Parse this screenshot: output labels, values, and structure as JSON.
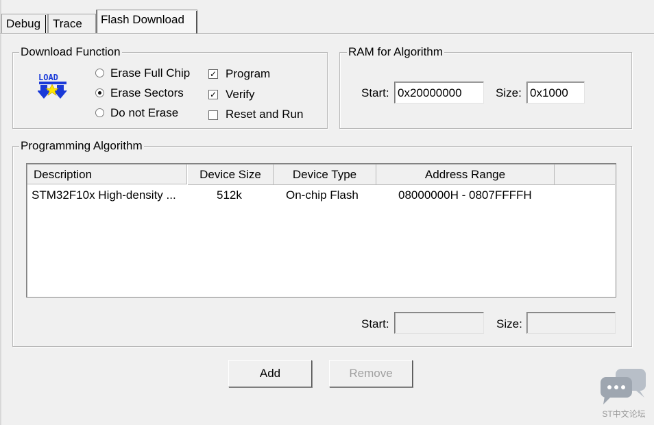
{
  "tabs": [
    {
      "label": "Debug"
    },
    {
      "label": "Trace"
    },
    {
      "label": "Flash Download",
      "active": true
    }
  ],
  "download_function": {
    "title": "Download Function",
    "icon_text": "LOAD",
    "erase_options": [
      {
        "label": "Erase Full Chip",
        "selected": false
      },
      {
        "label": "Erase Sectors",
        "selected": true
      },
      {
        "label": "Do not Erase",
        "selected": false
      }
    ],
    "checks": [
      {
        "label": "Program",
        "checked": true
      },
      {
        "label": "Verify",
        "checked": true
      },
      {
        "label": "Reset and Run",
        "checked": false
      }
    ]
  },
  "ram": {
    "title": "RAM for Algorithm",
    "start_label": "Start:",
    "start_value": "0x20000000",
    "size_label": "Size:",
    "size_value": "0x1000"
  },
  "algorithm": {
    "title": "Programming Algorithm",
    "columns": [
      "Description",
      "Device Size",
      "Device Type",
      "Address Range",
      ""
    ],
    "rows": [
      {
        "description": "STM32F10x High-density ...",
        "size": "512k",
        "type": "On-chip Flash",
        "range": "08000000H - 0807FFFFH"
      }
    ],
    "start_label": "Start:",
    "start_value": "",
    "size_label": "Size:",
    "size_value": ""
  },
  "buttons": {
    "add": "Add",
    "remove": "Remove"
  },
  "watermark": {
    "text": "ST中文论坛"
  },
  "colors": {
    "icon_blue": "#1a3ad8",
    "icon_yellow": "#ffe600"
  }
}
